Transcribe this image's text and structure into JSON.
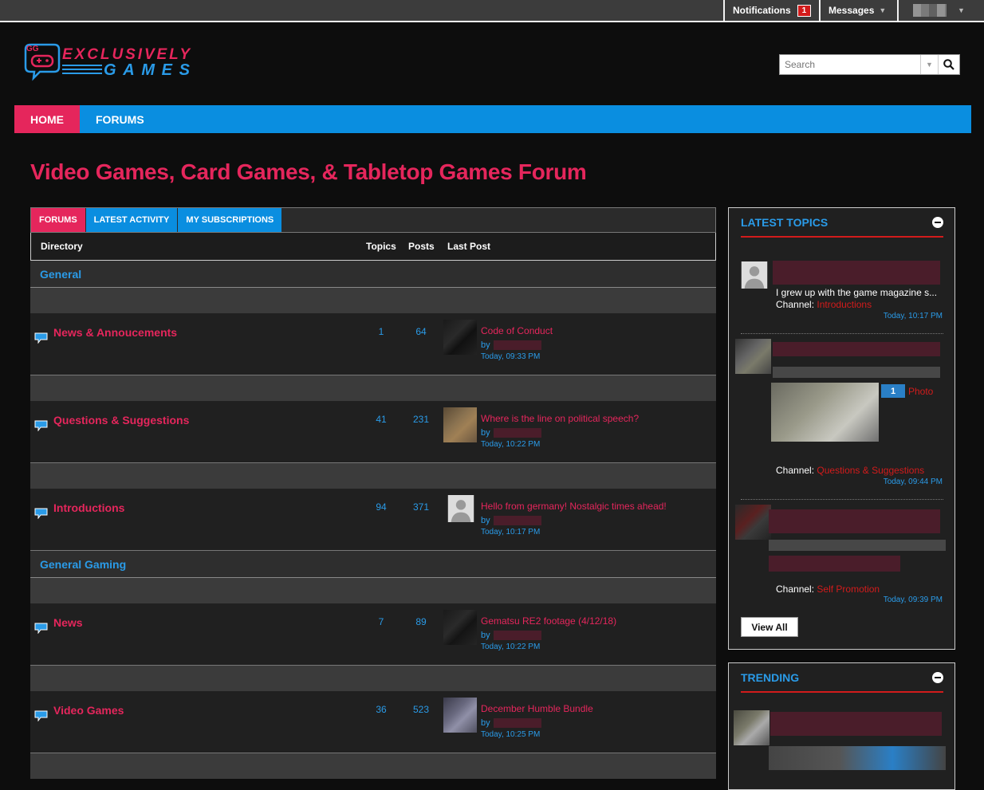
{
  "topbar": {
    "notifications_label": "Notifications",
    "notifications_count": "1",
    "messages_label": "Messages"
  },
  "brand": {
    "logo_line1": "EXCLUSIVELY",
    "logo_line2": "GAMES",
    "logo_badge": "GG"
  },
  "search": {
    "placeholder": "Search"
  },
  "nav": {
    "items": [
      {
        "label": "HOME"
      },
      {
        "label": "FORUMS"
      }
    ]
  },
  "page_title": "Video Games, Card Games, & Tabletop Games Forum",
  "tabs": [
    {
      "label": "FORUMS"
    },
    {
      "label": "LATEST ACTIVITY"
    },
    {
      "label": "MY SUBSCRIPTIONS"
    }
  ],
  "columns": {
    "directory": "Directory",
    "topics": "Topics",
    "posts": "Posts",
    "last_post": "Last Post"
  },
  "categories": [
    {
      "name": "General",
      "forums": [
        {
          "name": "News & Annoucements",
          "topics": "1",
          "posts": "64",
          "last_title": "Code of Conduct",
          "by": "by",
          "time": "Today, 09:33 PM"
        },
        {
          "name": "Questions & Suggestions",
          "topics": "41",
          "posts": "231",
          "last_title": "Where is the line on political speech?",
          "by": "by",
          "time": "Today, 10:22 PM"
        },
        {
          "name": "Introductions",
          "topics": "94",
          "posts": "371",
          "last_title": "Hello from germany! Nostalgic times ahead!",
          "by": "by",
          "time": "Today, 10:17 PM"
        }
      ]
    },
    {
      "name": "General Gaming",
      "forums": [
        {
          "name": "News",
          "topics": "7",
          "posts": "89",
          "last_title": "Gematsu RE2 footage (4/12/18)",
          "by": "by",
          "time": "Today, 10:22 PM"
        },
        {
          "name": "Video Games",
          "topics": "36",
          "posts": "523",
          "last_title": "December Humble Bundle",
          "by": "by",
          "time": "Today, 10:25 PM"
        }
      ]
    }
  ],
  "latest_topics": {
    "title": "LATEST TOPICS",
    "items": [
      {
        "snippet": "I grew up with the game magazine s...",
        "channel_label": "Channel:",
        "channel": "Introductions",
        "time": "Today, 10:17 PM"
      },
      {
        "photo_count": "1",
        "photo_label": "Photo",
        "channel_label": "Channel:",
        "channel": "Questions & Suggestions",
        "time": "Today, 09:44 PM"
      },
      {
        "channel_label": "Channel:",
        "channel": "Self Promotion",
        "time": "Today, 09:39 PM"
      }
    ],
    "view_all": "View All"
  },
  "trending": {
    "title": "TRENDING"
  },
  "colors": {
    "accent_pink": "#e5265c",
    "accent_blue": "#0a8ee0",
    "link_blue": "#2a9be8",
    "red": "#d21b1b"
  }
}
